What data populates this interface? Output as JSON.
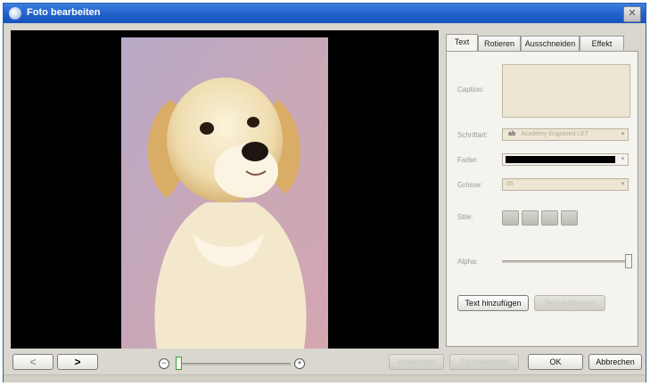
{
  "window": {
    "title": "Foto bearbeiten",
    "close_label": "✕"
  },
  "tabs": [
    "Text",
    "Rotieren",
    "Ausschneiden",
    "Effekt"
  ],
  "text_tab": {
    "caption_label": "Caption:",
    "font_label": "Schriftart:",
    "font_value": "Academy Engraved LET",
    "font_prefix": "ab",
    "color_label": "Farbe:",
    "color_value": "#000000",
    "size_label": "Grösse:",
    "size_value": "35",
    "style_label": "Stile:",
    "style_buttons": [
      "B",
      "I",
      "U",
      "S"
    ],
    "alpha_label": "Alpha:",
    "alpha_level": 1.0,
    "add_text_button": "Text hinzufügen",
    "remove_text_button": "Text entfernen"
  },
  "bottom_bar": {
    "prev_label": "<",
    "next_label": ">",
    "zoom_out": "−",
    "zoom_in": "+",
    "zoom_level": 0.0,
    "disabled_button_1": "Anwenden",
    "disabled_button_2": "Zurücksetzen",
    "ok_label": "OK",
    "cancel_label": "Abbrechen"
  }
}
